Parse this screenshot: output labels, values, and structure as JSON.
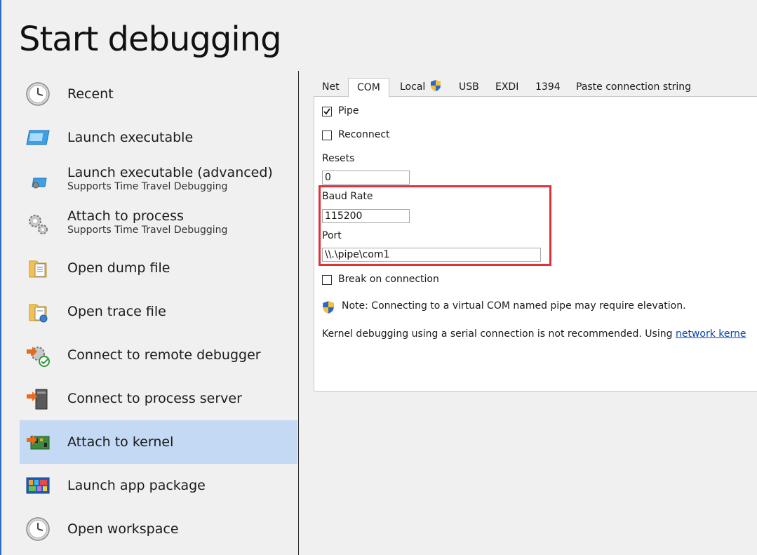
{
  "title": "Start debugging",
  "sidebar": {
    "items": [
      {
        "label": "Recent",
        "sub": "",
        "icon": "clock-icon"
      },
      {
        "label": "Launch executable",
        "sub": "",
        "icon": "window-icon"
      },
      {
        "label": "Launch executable (advanced)",
        "sub": "Supports Time Travel Debugging",
        "icon": "window-gear-icon"
      },
      {
        "label": "Attach to process",
        "sub": "Supports Time Travel Debugging",
        "icon": "gears-icon"
      },
      {
        "label": "Open dump file",
        "sub": "",
        "icon": "dump-file-icon"
      },
      {
        "label": "Open trace file",
        "sub": "",
        "icon": "trace-file-icon"
      },
      {
        "label": "Connect to remote debugger",
        "sub": "",
        "icon": "remote-debugger-icon"
      },
      {
        "label": "Connect to process server",
        "sub": "",
        "icon": "process-server-icon"
      },
      {
        "label": "Attach to kernel",
        "sub": "",
        "icon": "kernel-board-icon",
        "selected": true
      },
      {
        "label": "Launch app package",
        "sub": "",
        "icon": "app-package-icon"
      },
      {
        "label": "Open workspace",
        "sub": "",
        "icon": "clock-icon"
      }
    ],
    "selected_color": "#c4d9f3"
  },
  "tabs": {
    "net": "Net",
    "com": "COM",
    "local": "Local",
    "usb": "USB",
    "exdi": "EXDI",
    "n1394": "1394",
    "paste": "Paste connection string",
    "active": "COM"
  },
  "com": {
    "pipe_label": "Pipe",
    "pipe_checked": true,
    "reconnect_label": "Reconnect",
    "reconnect_checked": false,
    "resets_label": "Resets",
    "resets_value": "0",
    "baud_label": "Baud Rate",
    "baud_value": "115200",
    "port_label": "Port",
    "port_value": "\\\\.\\pipe\\com1",
    "break_label": "Break on connection",
    "break_checked": false,
    "note": "Note: Connecting to a virtual COM named pipe may require elevation.",
    "kernel_text": "Kernel debugging using a serial connection is not recommended. Using ",
    "kernel_link": "network kerne",
    "highlight_color": "#e0303a"
  }
}
